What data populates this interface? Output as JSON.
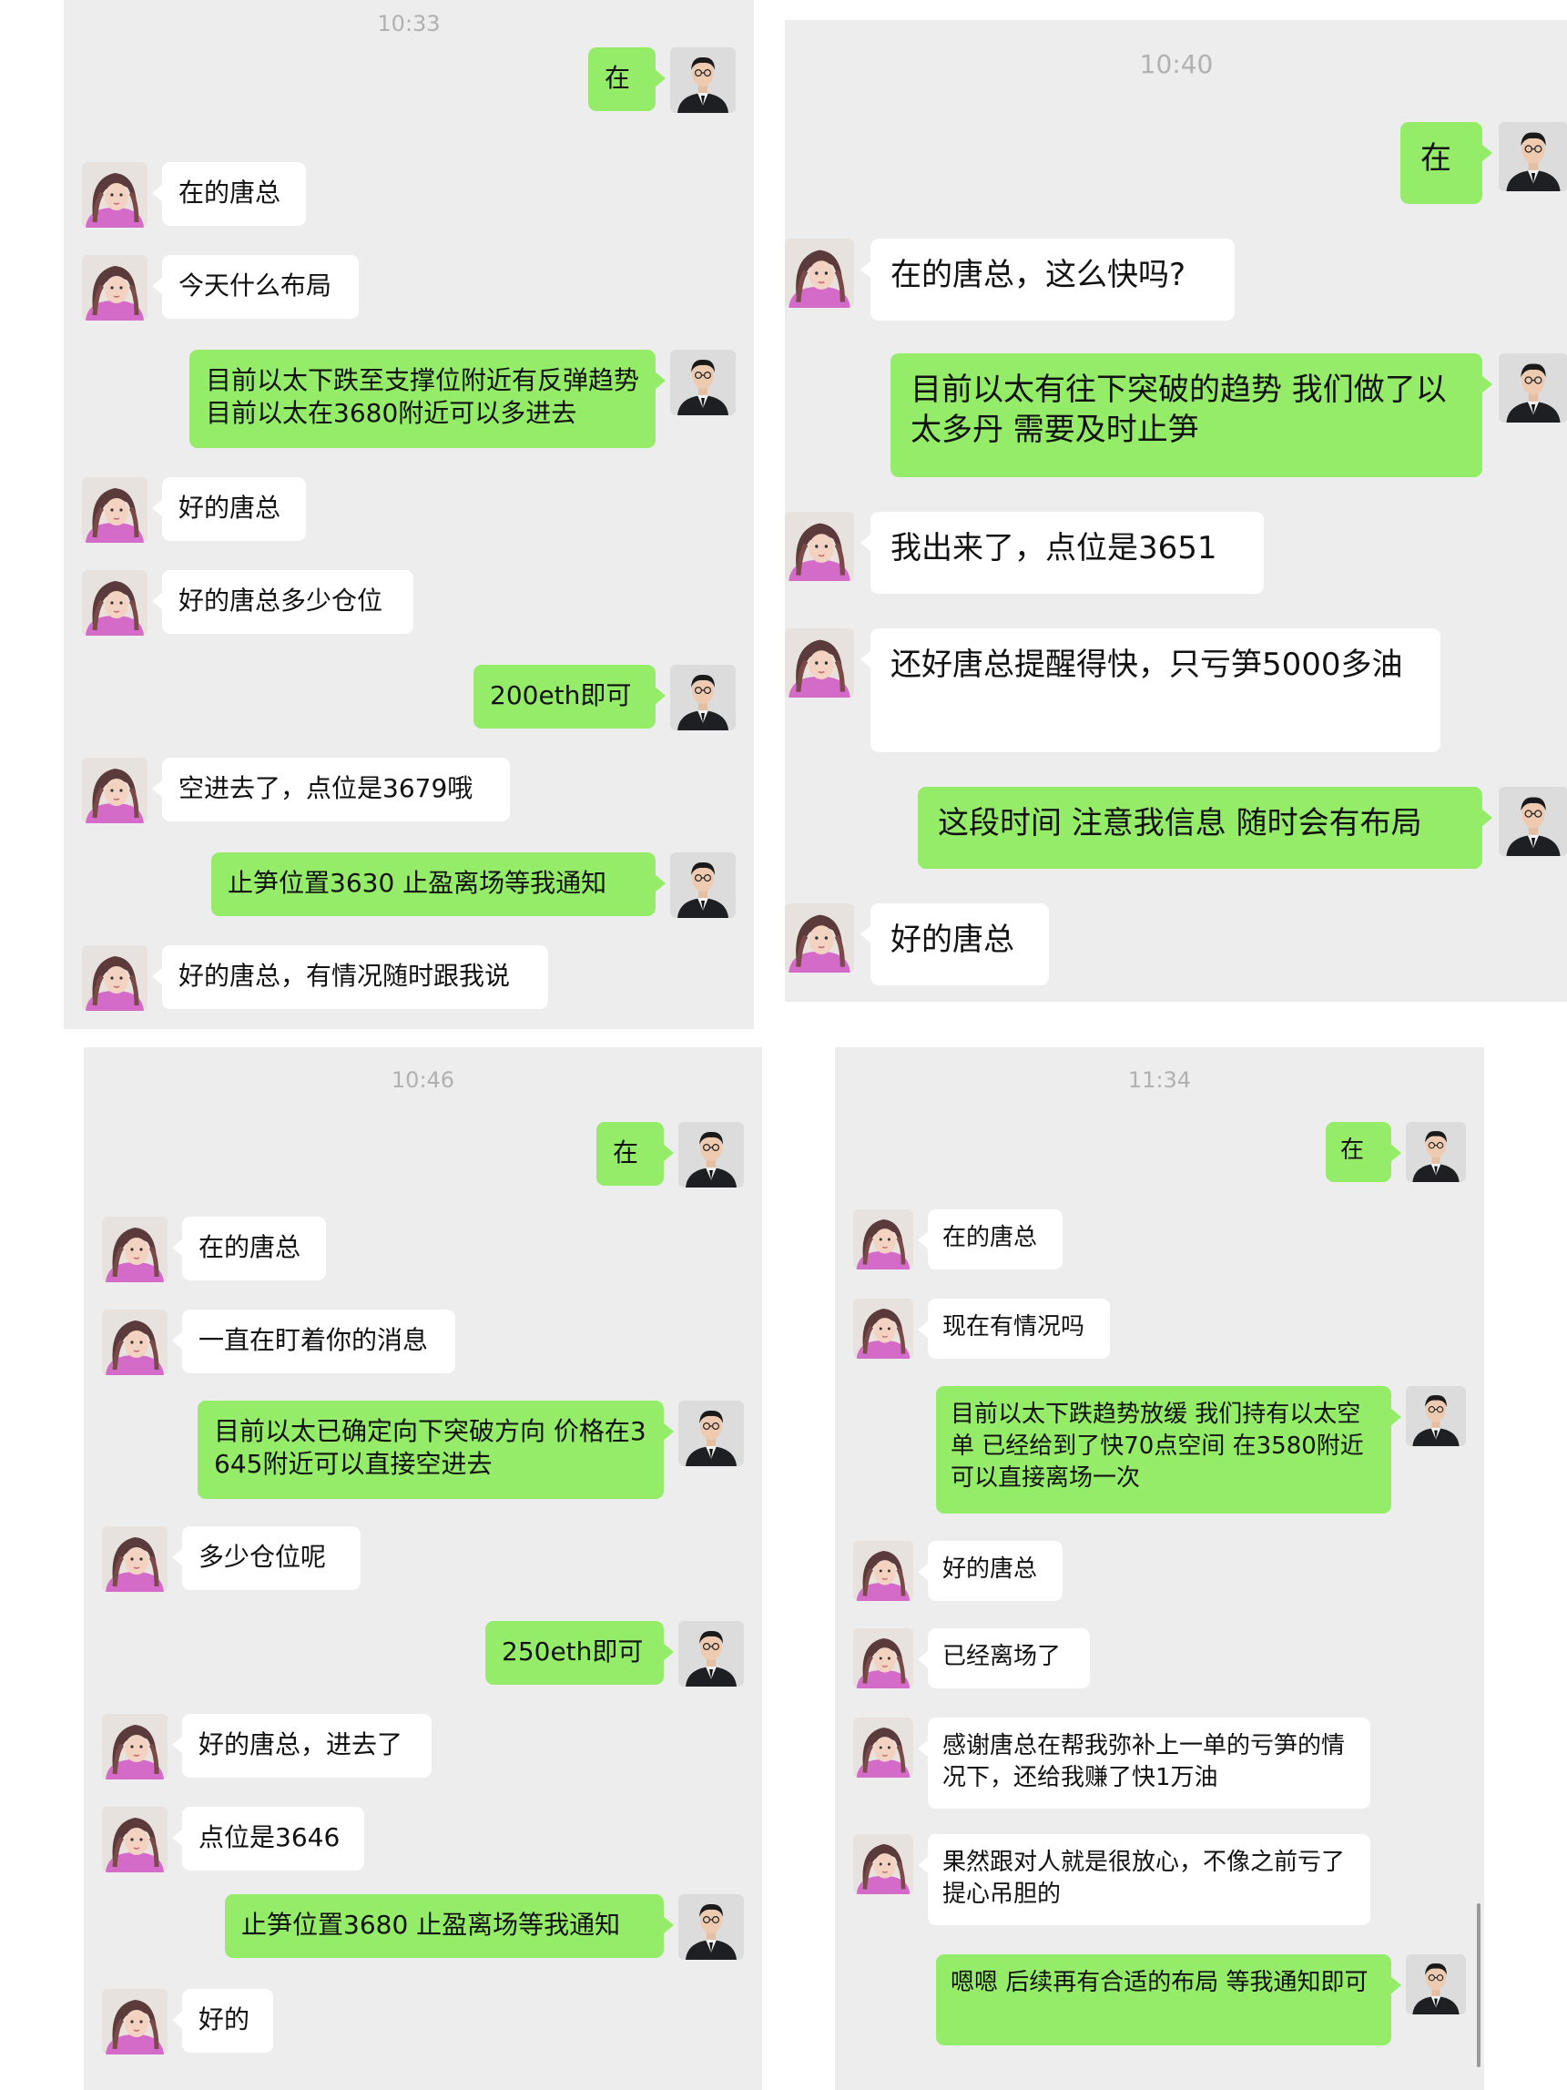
{
  "panels": [
    {
      "time": "10:33",
      "messages": [
        {
          "side": "me",
          "text": "在"
        },
        {
          "side": "her",
          "text": "在的唐总"
        },
        {
          "side": "her",
          "text": "今天什么布局"
        },
        {
          "side": "me",
          "text": "目前以太下跌至支撑位附近有反弹趋势 目前以太在3680附近可以多进去"
        },
        {
          "side": "her",
          "text": "好的唐总"
        },
        {
          "side": "her",
          "text": "好的唐总多少仓位"
        },
        {
          "side": "me",
          "text": "200eth即可"
        },
        {
          "side": "her",
          "text": "空进去了，点位是3679哦"
        },
        {
          "side": "me",
          "text": "止笋位置3630  止盈离场等我通知"
        },
        {
          "side": "her",
          "text": "好的唐总，有情况随时跟我说"
        }
      ]
    },
    {
      "time": "10:40",
      "messages": [
        {
          "side": "me",
          "text": "在"
        },
        {
          "side": "her",
          "text": "在的唐总，这么快吗?"
        },
        {
          "side": "me",
          "text": "目前以太有往下突破的趋势 我们做了以太多丹 需要及时止笋"
        },
        {
          "side": "her",
          "text": "我出来了，点位是3651"
        },
        {
          "side": "her",
          "text": "还好唐总提醒得快，只亏笋5000多油"
        },
        {
          "side": "me",
          "text": "这段时间 注意我信息 随时会有布局"
        },
        {
          "side": "her",
          "text": "好的唐总"
        }
      ]
    },
    {
      "time": "10:46",
      "messages": [
        {
          "side": "me",
          "text": "在"
        },
        {
          "side": "her",
          "text": "在的唐总"
        },
        {
          "side": "her",
          "text": "一直在盯着你的消息"
        },
        {
          "side": "me",
          "text": "目前以太已确定向下突破方向 价格在3645附近可以直接空进去"
        },
        {
          "side": "her",
          "text": "多少仓位呢"
        },
        {
          "side": "me",
          "text": "250eth即可"
        },
        {
          "side": "her",
          "text": "好的唐总，进去了"
        },
        {
          "side": "her",
          "text": "点位是3646"
        },
        {
          "side": "me",
          "text": "止笋位置3680  止盈离场等我通知"
        },
        {
          "side": "her",
          "text": "好的"
        }
      ]
    },
    {
      "time": "11:34",
      "messages": [
        {
          "side": "me",
          "text": "在"
        },
        {
          "side": "her",
          "text": "在的唐总"
        },
        {
          "side": "her",
          "text": "现在有情况吗"
        },
        {
          "side": "me",
          "text": "目前以太下跌趋势放缓 我们持有以太空单 已经给到了快70点空间 在3580附近可以直接离场一次"
        },
        {
          "side": "her",
          "text": "好的唐总"
        },
        {
          "side": "her",
          "text": "已经离场了"
        },
        {
          "side": "her",
          "text": "感谢唐总在帮我弥补上一单的亏笋的情况下，还给我赚了快1万油"
        },
        {
          "side": "her",
          "text": "果然跟对人就是很放心，不像之前亏了提心吊胆的"
        },
        {
          "side": "me",
          "text": "嗯嗯 后续再有合适的布局 等我通知即可"
        }
      ]
    }
  ],
  "avatars": {
    "me": "man-in-suit-avatar",
    "her": "woman-avatar"
  },
  "colors": {
    "panel_bg": "#ededed",
    "my_bubble": "#95ec69",
    "her_bubble": "#ffffff",
    "time": "#b1b1b1"
  }
}
